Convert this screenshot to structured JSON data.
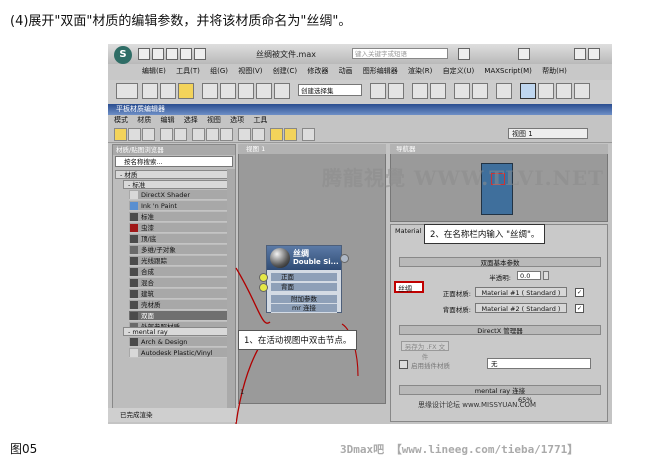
{
  "caption": "(4)展开\"双面\"材质的编辑参数，并将该材质命名为\"丝绸\"。",
  "figure_label": "图05",
  "footer_credit": "3Dmax吧 【www.lineeg.com/tieba/1771】",
  "app": {
    "logo_glyph": "S",
    "window_title": "丝绸被文件.max",
    "search_placeholder": "键入关键字或短语",
    "menu": [
      "编辑(E)",
      "工具(T)",
      "组(G)",
      "视图(V)",
      "创建(C)",
      "修改器",
      "动画",
      "图形编辑器",
      "渲染(R)",
      "自定义(U)",
      "MAXScript(M)",
      "帮助(H)"
    ],
    "toolbar_selection_set": "创建选择集"
  },
  "sme": {
    "title": "平板材质编辑器",
    "menu": [
      "模式",
      "材质",
      "编辑",
      "选择",
      "视图",
      "选项",
      "工具"
    ],
    "view_selector": "视图 1",
    "browser": {
      "header": "材质/贴图浏览器",
      "search_placeholder": "按名称搜索...",
      "group_materials": "- 材质",
      "group_standard": "- 标准",
      "items": [
        {
          "label": "DirectX Shader",
          "color": "#d8d8d8"
        },
        {
          "label": "Ink 'n Paint",
          "color": "#5a8fd0"
        },
        {
          "label": "标准",
          "color": "#4b4b4b"
        },
        {
          "label": "虫漆",
          "color": "#a01818"
        },
        {
          "label": "顶/底",
          "color": "#4b4b4b"
        },
        {
          "label": "多维/子对象",
          "color": "#6a6a6a"
        },
        {
          "label": "光线跟踪",
          "color": "#4b4b4b"
        },
        {
          "label": "合成",
          "color": "#4b4b4b"
        },
        {
          "label": "混合",
          "color": "#4b4b4b"
        },
        {
          "label": "建筑",
          "color": "#4b4b4b"
        },
        {
          "label": "壳材质",
          "color": "#4b4b4b"
        },
        {
          "label": "双面",
          "color": "#4b4b4b"
        },
        {
          "label": "外部参照材质",
          "color": "#6a6a6a"
        }
      ],
      "selected_index": 11,
      "group_mental_ray": "- mental ray",
      "mr_items": [
        {
          "label": "Arch & Design",
          "color": "#4b4b4b"
        },
        {
          "label": "Autodesk Plastic/Vinyl",
          "color": "#d8d8d8"
        }
      ]
    },
    "view_tab": "视图 1",
    "navigator_tab": "导航器",
    "node": {
      "title": "丝绸",
      "subtitle": "Double Si...",
      "slots": [
        "正面",
        "背面"
      ],
      "footer_1": "附加参数",
      "footer_2": "mr 连接"
    },
    "params": {
      "header": "Material",
      "name_value": "丝绸",
      "rollout_basic": "双面基本参数",
      "translucency_label": "半透明:",
      "translucency_value": "0.0",
      "facing_label": "正面材质:",
      "facing_material": "Material #1  ( Standard )",
      "back_label": "背面材质:",
      "back_material": "Material #2  ( Standard )",
      "rollout_directx": "DirectX 管理器",
      "save_fx_button": "另存为 .FX 文件",
      "enable_plugin_label": "启用插件材质",
      "plugin_value": "无",
      "rollout_mr": "mental ray 连接"
    },
    "status_text": "已完成渲染",
    "zoom": "65%",
    "page_number": "1"
  },
  "callouts": {
    "step1": "1、在活动视图中双击节点。",
    "step2": "2、在名称栏内输入 \"丝绸\"。"
  },
  "watermarks": {
    "main": "腾龍視覺 WWW.TLVI.NET",
    "secondary": "思缘设计论坛 www.MISSYUAN.COM"
  }
}
